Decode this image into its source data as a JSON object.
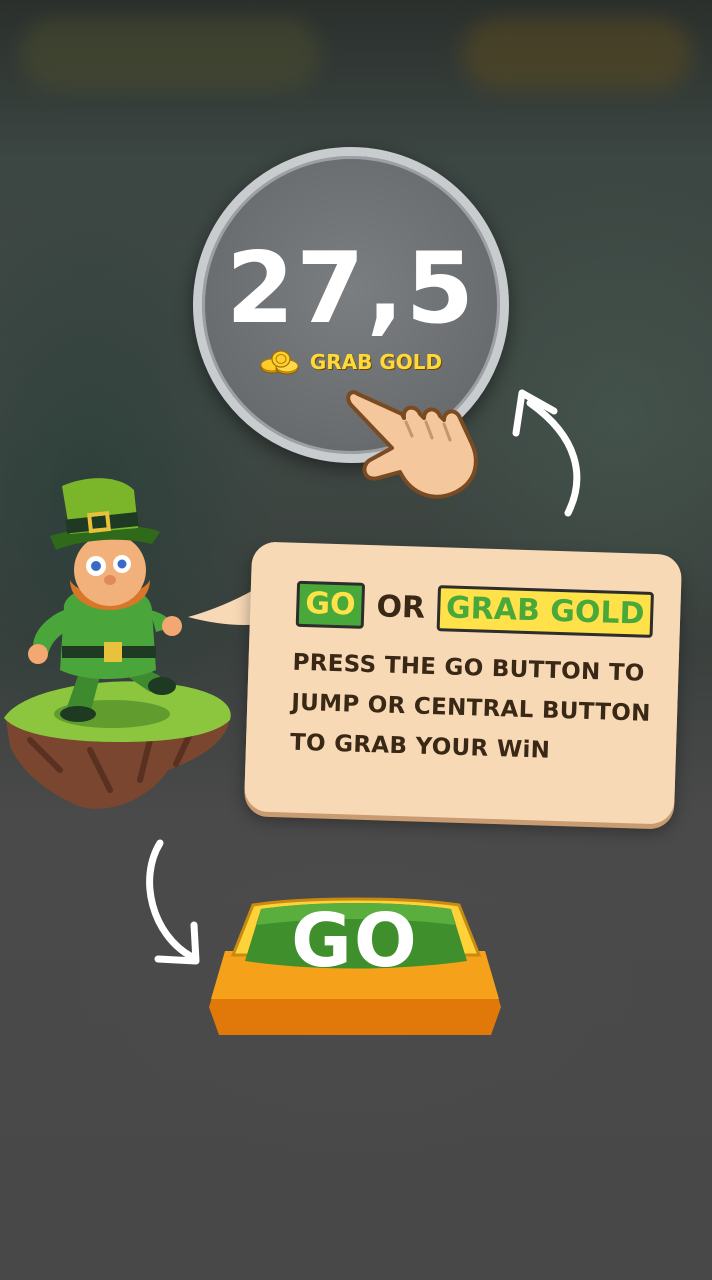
{
  "central_button": {
    "value": "27,5",
    "label": "GRAB GOLD",
    "coin_icon": "gold-coins-icon"
  },
  "tutorial": {
    "title_go": "GO",
    "title_or": "OR",
    "title_grab": "GRAB GOLD",
    "line1": "PRESS THE GO BUTTON TO",
    "line2": "JUMP OR CENTRAL BUTTON",
    "line3": "TO GRAB YOUR WiN"
  },
  "go_button": {
    "label": "GO"
  },
  "icons": [
    "pointing-hand-icon",
    "curved-arrow-up-icon",
    "curved-arrow-down-icon"
  ],
  "colors": {
    "go_green": "#49a83a",
    "gold_yellow": "#ffe14a",
    "bubble": "#f8d9b6",
    "text_brown": "#3a2816"
  }
}
